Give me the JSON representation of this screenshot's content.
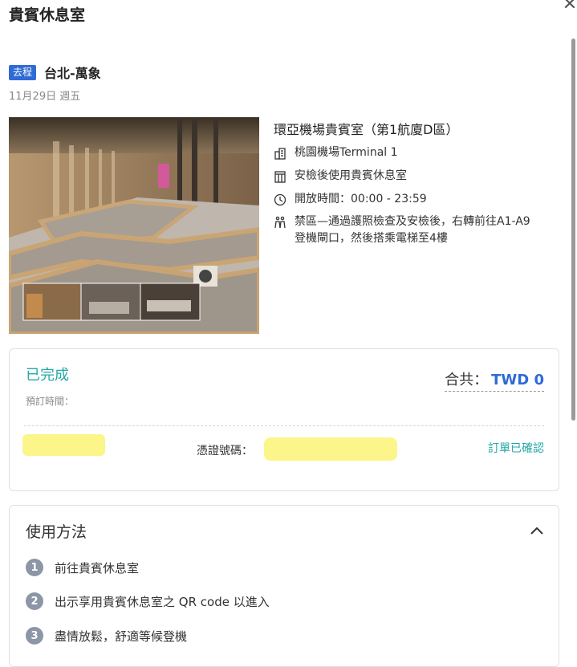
{
  "header": {
    "title": "貴賓休息室",
    "close_icon": "close-icon"
  },
  "trip": {
    "badge": "去程",
    "route": "台北-萬象",
    "date": "11月29日 週五"
  },
  "lounge": {
    "name": "環亞機場貴賓室（第1航廈D區）",
    "location": "桃園機場Terminal 1",
    "access": "安檢後使用貴賓休息室",
    "hours": "開放時間：00:00 - 23:59",
    "directions": "禁區—通過護照檢查及安檢後，右轉前往A1-A9登機閘口，然後搭乘電梯至4樓",
    "icons": [
      "building-icon",
      "gate-icon",
      "clock-icon",
      "walking-icon"
    ]
  },
  "booking": {
    "status": "已完成",
    "booked_time_label": "預訂時間：",
    "total_label": "合共：",
    "total_value": "TWD 0",
    "voucher_label": "憑證號碼：",
    "order_status": "訂單已確認"
  },
  "howto": {
    "title": "使用方法",
    "steps": [
      {
        "num": "1",
        "text": "前往貴賓休息室"
      },
      {
        "num": "2",
        "text": "出示享用貴賓休息室之 QR code 以進入"
      },
      {
        "num": "3",
        "text": "盡情放鬆，舒適等候登機"
      }
    ]
  },
  "colors": {
    "accent_blue": "#2f6bd6",
    "teal": "#25a8a8",
    "redaction": "#fcf58a"
  }
}
